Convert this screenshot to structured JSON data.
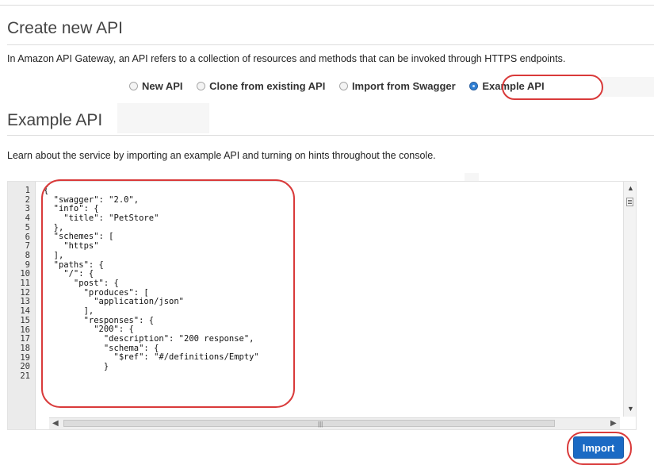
{
  "page": {
    "create_title": "Create new API",
    "intro": "In Amazon API Gateway, an API refers to a collection of resources and methods that can be invoked through HTTPS endpoints.",
    "options": [
      {
        "label": "New API",
        "selected": false
      },
      {
        "label": "Clone from existing API",
        "selected": false
      },
      {
        "label": "Import from Swagger",
        "selected": false
      },
      {
        "label": "Example API",
        "selected": true
      }
    ],
    "example_title": "Example API",
    "learn_text": "Learn about the service by importing an example API and turning on hints throughout the console."
  },
  "editor": {
    "line_numbers": [
      "1",
      "2",
      "3",
      "4",
      "5",
      "6",
      "7",
      "8",
      "9",
      "10",
      "11",
      "12",
      "13",
      "14",
      "15",
      "16",
      "17",
      "18",
      "19",
      "20",
      "21"
    ],
    "lines": [
      "{",
      "  \"swagger\": \"2.0\",",
      "  \"info\": {",
      "    \"title\": \"PetStore\"",
      "  },",
      "  \"schemes\": [",
      "    \"https\"",
      "  ],",
      "  \"paths\": {",
      "    \"/\": {",
      "      \"post\": {",
      "        \"produces\": [",
      "          \"application/json\"",
      "        ],",
      "        \"responses\": {",
      "          \"200\": {",
      "            \"description\": \"200 response\",",
      "            \"schema\": {",
      "              \"$ref\": \"#/definitions/Empty\"",
      "            }",
      ""
    ]
  },
  "actions": {
    "import_label": "Import"
  },
  "colors": {
    "highlight_ring": "#d93a3a",
    "primary_button": "#1b6ac4",
    "radio_selected": "#2f7fd4"
  }
}
